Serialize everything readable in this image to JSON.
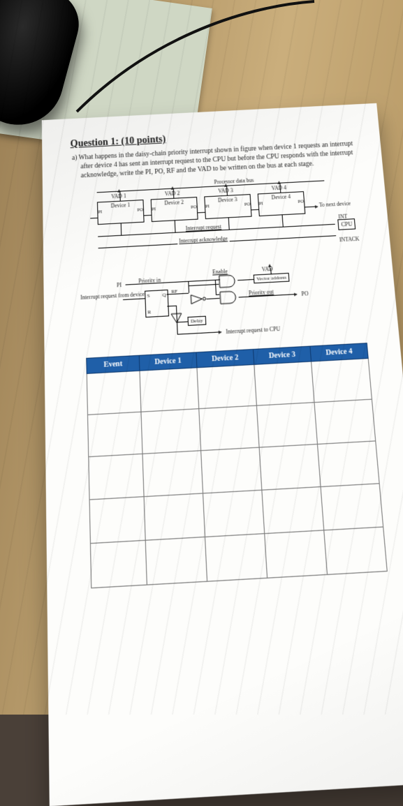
{
  "question": {
    "heading": "Question 1: (10 points)",
    "part_a": "a)  What happens in the daisy-chain priority interrupt shown in figure when device 1 requests an interrupt after device 4 has sent an interrupt request to the CPU but before the CPU responds with the interrupt acknowledge, write the PI, PO, RF and the VAD to be written on the bus at each stage."
  },
  "diagram": {
    "bus_label": "Processor data bus",
    "vad": [
      "VAD 1",
      "VAD 2",
      "VAD 3",
      "VAD 4"
    ],
    "devices": [
      "Device 1",
      "Device 2",
      "Device 3",
      "Device 4"
    ],
    "pin_in": "PI",
    "pin_out": "PO",
    "to_next": "To next device",
    "int_req": "Interrupt request",
    "int_ack": "Interrupt acknowledge",
    "cpu": "CPU",
    "int": "INT",
    "intack": "INTACK"
  },
  "logic": {
    "pi": "PI",
    "priority_in": "Priority in",
    "int_req_from": "Interrupt request from device",
    "rf": "RF",
    "s": "S",
    "q": "Q",
    "r": "R",
    "enable": "Enable",
    "vad": "VAD",
    "vector_addr": "Vector address",
    "priority_out": "Priority out",
    "po": "PO",
    "delay": "Delay",
    "irq_cpu": "Interrupt request to CPU"
  },
  "table": {
    "headers": [
      "Event",
      "Device 1",
      "Device 2",
      "Device 3",
      "Device 4"
    ],
    "blank_rows": 5
  }
}
